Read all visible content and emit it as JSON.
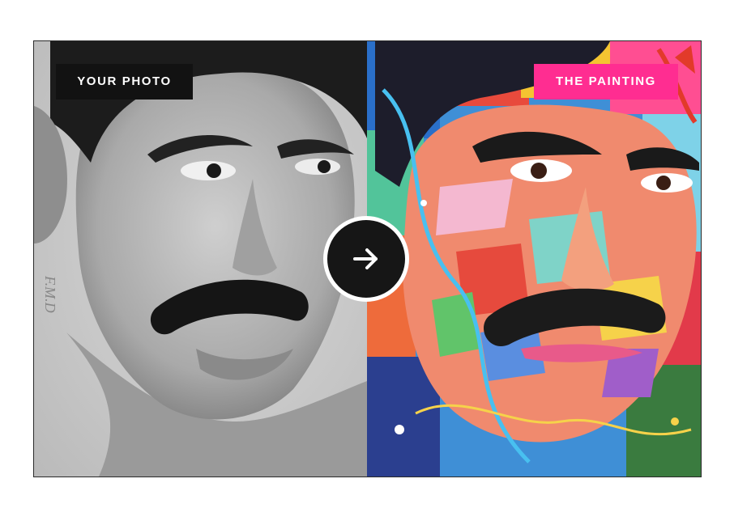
{
  "labels": {
    "before": "YOUR PHOTO",
    "after": "THE PAINTING"
  },
  "colors": {
    "before_label_bg": "#121212",
    "after_label_bg": "#ff2d91",
    "button_bg": "#161616"
  },
  "icons": {
    "compare": "arrow-right-icon"
  }
}
